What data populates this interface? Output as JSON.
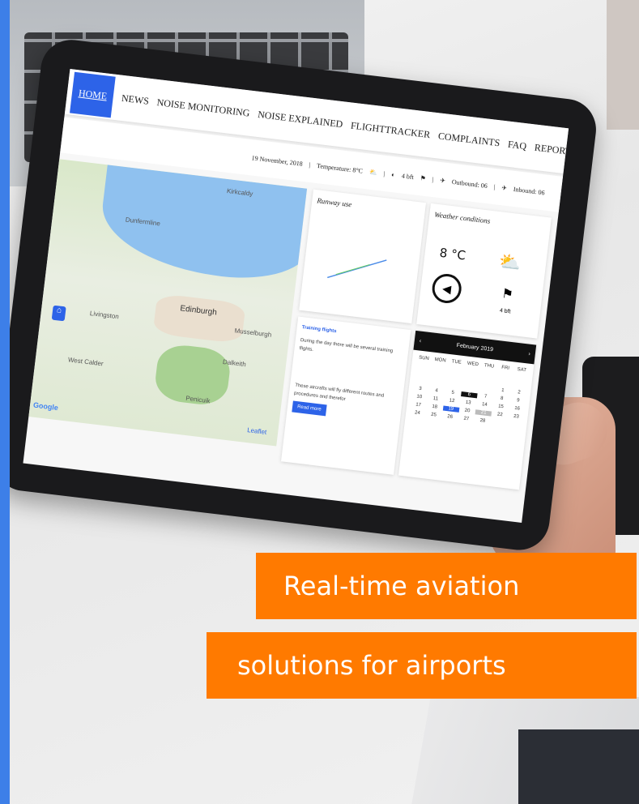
{
  "nav": {
    "items": [
      "HOME",
      "NEWS",
      "NOISE MONITORING",
      "NOISE EXPLAINED",
      "FLIGHTTRACKER",
      "COMPLAINTS",
      "FAQ",
      "REPORTS"
    ]
  },
  "infobar": {
    "date": "19 November, 2018",
    "temperature": "Temperature: 8°C",
    "wind": "4 bft",
    "outbound": "Outbound: 06",
    "inbound": "Inbound: 06"
  },
  "map": {
    "labels": [
      "Dunfermline",
      "Edinburgh",
      "Livingston",
      "Kirkcaldy",
      "Musselburgh",
      "Dalkeith",
      "Penicuik",
      "West Calder"
    ],
    "attribution": "Google",
    "leaflet": "Leaflet"
  },
  "runway": {
    "title": "Runway use"
  },
  "weather": {
    "title": "Weather conditions",
    "temp": "8 °C",
    "wind": "4 bft"
  },
  "training": {
    "title": "Training flights",
    "text1": "During the day there will be several training flights.",
    "text2": "These aircrafts will fly different routes and procedures and therefor",
    "button": "Read more"
  },
  "calendar": {
    "month": "February 2019",
    "days": [
      "SUN",
      "MON",
      "TUE",
      "WED",
      "THU",
      "FRI",
      "SAT"
    ],
    "cells": [
      "",
      "",
      "",
      "",
      "",
      "1",
      "2",
      "3",
      "4",
      "5",
      "6",
      "7",
      "8",
      "9",
      "10",
      "11",
      "12",
      "13",
      "14",
      "15",
      "16",
      "17",
      "18",
      "19",
      "20",
      "21",
      "22",
      "23",
      "24",
      "25",
      "26",
      "27",
      "28"
    ]
  },
  "banner": {
    "line1": "Real-time aviation",
    "line2": "solutions for airports"
  },
  "colors": {
    "accent": "#2d63e8",
    "orange": "#ff7a00",
    "stripe": "#3d7fe8"
  }
}
